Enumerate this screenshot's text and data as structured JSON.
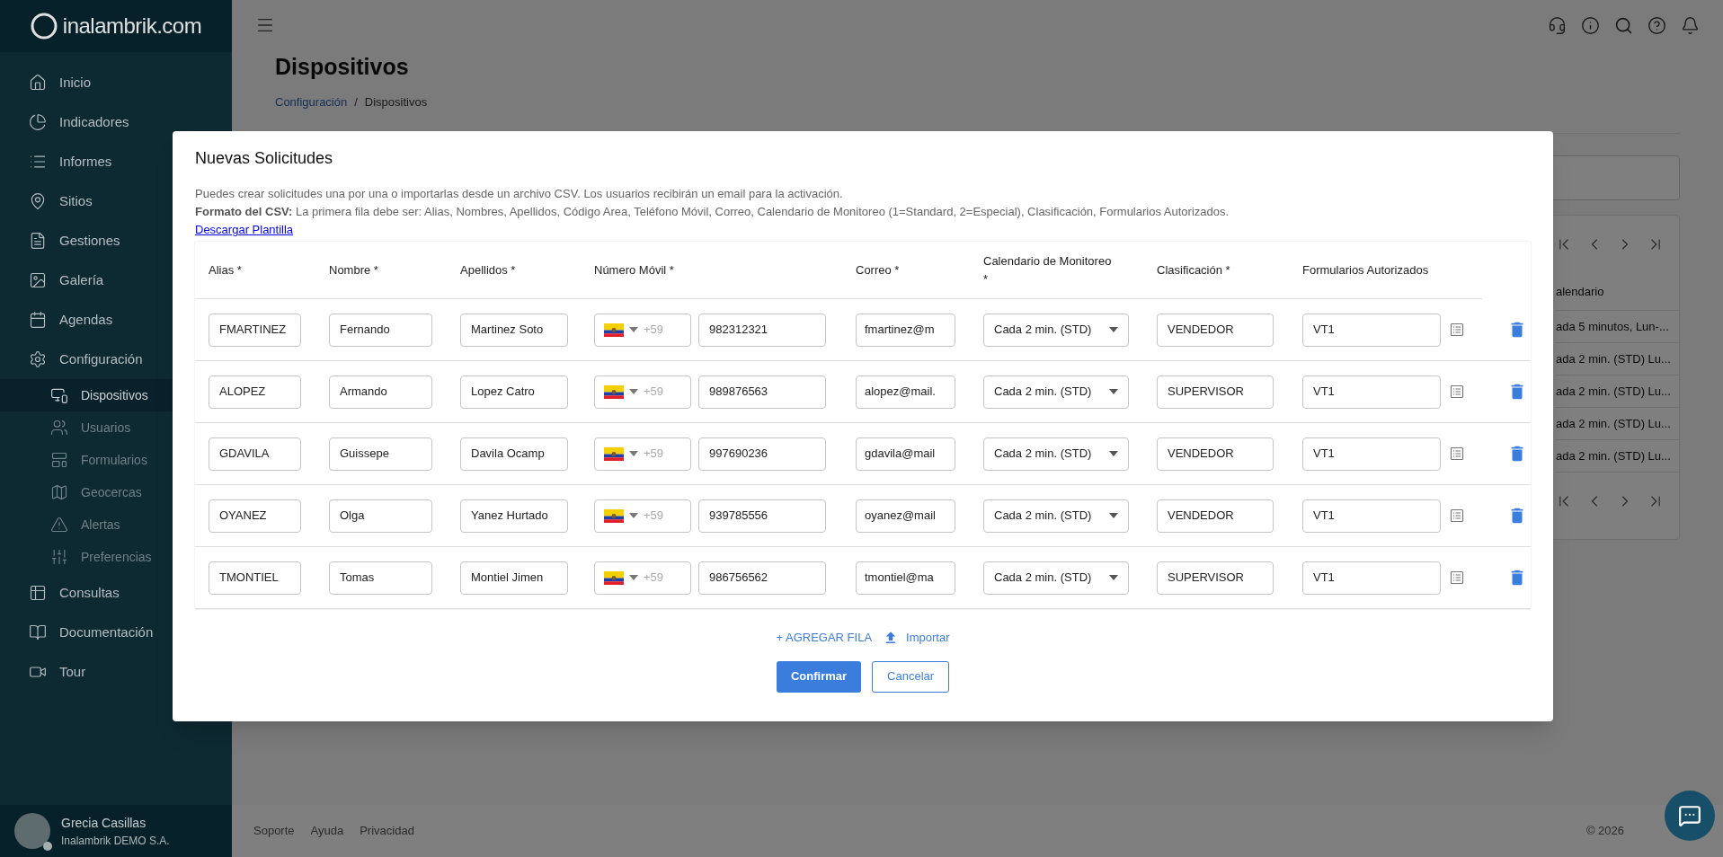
{
  "sidebar": {
    "logo": "inalambrik.com",
    "items": [
      {
        "label": "Inicio",
        "selected": false
      },
      {
        "label": "Indicadores",
        "selected": false
      },
      {
        "label": "Informes",
        "selected": false
      },
      {
        "label": "Sitios",
        "selected": false
      },
      {
        "label": "Gestiones",
        "selected": false
      },
      {
        "label": "Galería",
        "selected": false
      },
      {
        "label": "Agendas",
        "selected": false
      },
      {
        "label": "Configuración",
        "selected": false,
        "children": [
          {
            "label": "Dispositivos",
            "selected": true
          },
          {
            "label": "Usuarios",
            "selected": false
          },
          {
            "label": "Formularios",
            "selected": false
          },
          {
            "label": "Geocercas",
            "selected": false
          },
          {
            "label": "Alertas",
            "selected": false
          },
          {
            "label": "Preferencias",
            "selected": false
          }
        ]
      },
      {
        "label": "Consultas",
        "selected": false
      },
      {
        "label": "Documentación",
        "selected": false
      },
      {
        "label": "Tour",
        "selected": false
      }
    ],
    "user": {
      "name": "Grecia Casillas",
      "company": "Inalambrik DEMO S.A."
    }
  },
  "page": {
    "title": "Dispositivos",
    "breadcrumb": [
      "Configuración",
      "/",
      "Dispositivos"
    ]
  },
  "background_table": {
    "column": "alendario",
    "rows": [
      "ada 5 minutos, Lun-...",
      "ada 2 min. (STD) Lu...",
      "ada 2 min. (STD) Lu...",
      "ada 2 min. (STD) Lu...",
      "ada 2 min. (STD) Lu..."
    ]
  },
  "modal": {
    "title": "Nuevas Solicitudes",
    "intro": "Puedes crear solicitudes una por una o importarlas desde un archivo CSV. Los usuarios recibirán un email para la activación.",
    "csv_format": "**Formato del CSV:** La primera fila debe ser: Alias, Nombres, Apellidos, Código Area, Teléfono Móvil, Correo, Calendario de Monitoreo (1=Standard, 2=Especial), Clasificación, Formularios Autorizados.",
    "template_link": "Descargar Plantilla",
    "columns": [
      "Alias *",
      "Nombre *",
      "Apellidos *",
      "Número Móvil *",
      "Correo *",
      "Calendario de Monitoreo *",
      "Clasificación *",
      "Formularios Autorizados"
    ],
    "rows": [
      {
        "alias": "FMARTINEZ",
        "nombre": "Fernando",
        "apellidos": "Martinez Soto",
        "code": "+59",
        "phone": "982312321",
        "correo": "fmartinez@m",
        "calendario": "Cada 2 min. (STD)",
        "clasificacion": "VENDEDOR",
        "formularios": "VT1"
      },
      {
        "alias": "ALOPEZ",
        "nombre": "Armando",
        "apellidos": "Lopez Catro",
        "code": "+59",
        "phone": "989876563",
        "correo": "alopez@mail.",
        "calendario": "Cada 2 min. (STD)",
        "clasificacion": "SUPERVISOR",
        "formularios": "VT1"
      },
      {
        "alias": "GDAVILA",
        "nombre": "Guissepe",
        "apellidos": "Davila Ocamp",
        "code": "+59",
        "phone": "997690236",
        "correo": "gdavila@mail",
        "calendario": "Cada 2 min. (STD)",
        "clasificacion": "VENDEDOR",
        "formularios": "VT1"
      },
      {
        "alias": "OYANEZ",
        "nombre": "Olga",
        "apellidos": "Yanez Hurtado",
        "code": "+59",
        "phone": "939785556",
        "correo": "oyanez@mail",
        "calendario": "Cada 2 min. (STD)",
        "clasificacion": "VENDEDOR",
        "formularios": "VT1"
      },
      {
        "alias": "TMONTIEL",
        "nombre": "Tomas",
        "apellidos": "Montiel Jimen",
        "code": "+59",
        "phone": "986756562",
        "correo": "tmontiel@ma",
        "calendario": "Cada 2 min. (STD)",
        "clasificacion": "SUPERVISOR",
        "formularios": "VT1"
      }
    ],
    "add_row": "+ AGREGAR FILA",
    "import": "Importar",
    "confirm": "Confirmar",
    "cancel": "Cancelar"
  },
  "footer": {
    "links": [
      "Soporte",
      "Ayuda",
      "Privacidad"
    ],
    "copyright": "© 2026"
  }
}
